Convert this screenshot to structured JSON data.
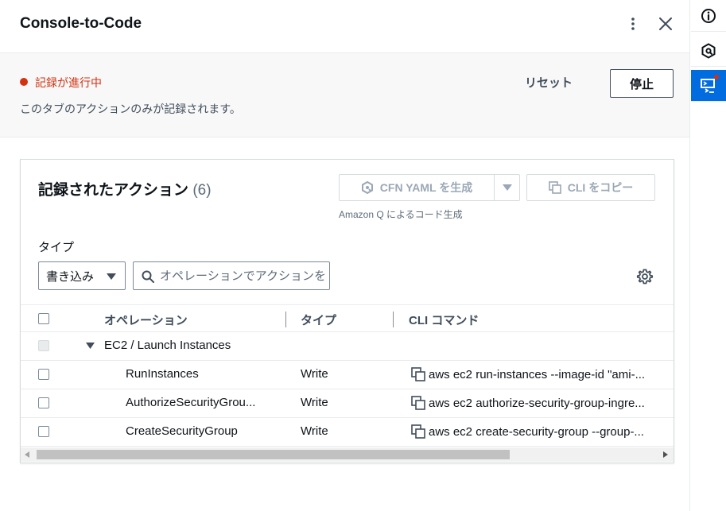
{
  "panel": {
    "title": "Console-to-Code",
    "icons": {
      "more": "more-vertical-icon",
      "close": "close-icon"
    }
  },
  "recording": {
    "status": "記録が進行中",
    "note": "このタブのアクションのみが記録されます。",
    "reset_label": "リセット",
    "stop_label": "停止",
    "status_color": "#d13212"
  },
  "actions": {
    "title": "記録されたアクション",
    "count": "(6)",
    "generate_label": "CFN YAML を生成",
    "generate_caption": "Amazon Q によるコード生成",
    "copy_label": "CLI をコピー",
    "filter": {
      "type_label": "タイプ",
      "type_value": "書き込み",
      "search_placeholder": "オペレーションでアクションを検索"
    },
    "columns": {
      "operation": "オペレーション",
      "type": "タイプ",
      "cli": "CLI コマンド"
    },
    "group": "EC2 / Launch Instances",
    "rows": [
      {
        "operation": "RunInstances",
        "type": "Write",
        "cli": "aws ec2 run-instances --image-id \"ami-..."
      },
      {
        "operation": "AuthorizeSecurityGrou...",
        "type": "Write",
        "cli": "aws ec2 authorize-security-group-ingre..."
      },
      {
        "operation": "CreateSecurityGroup",
        "type": "Write",
        "cli": "aws ec2 create-security-group --group-..."
      }
    ]
  },
  "rail": {
    "items": [
      "info-icon",
      "cloudshell-icon",
      "console-to-code-icon"
    ],
    "accent": "#006ce0"
  }
}
